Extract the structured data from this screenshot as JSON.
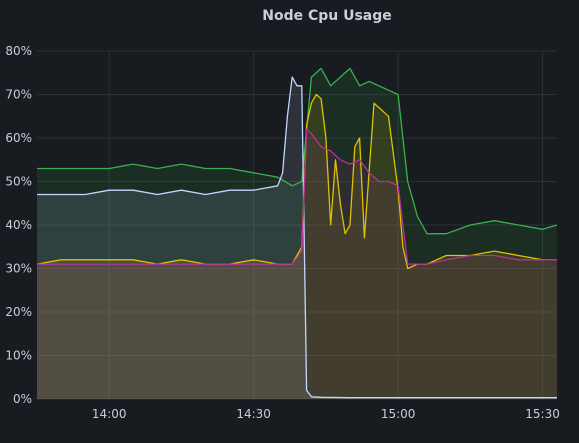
{
  "panel": {
    "title": "Node Cpu Usage"
  },
  "chart_data": {
    "type": "area",
    "title": "Node Cpu Usage",
    "xlabel": "",
    "ylabel": "",
    "x_ticks": [
      "14:00",
      "14:30",
      "15:00",
      "15:30"
    ],
    "y_ticks": [
      "0%",
      "10%",
      "20%",
      "30%",
      "40%",
      "50%",
      "60%",
      "70%",
      "80%"
    ],
    "xlim": [
      "13:45",
      "15:33"
    ],
    "ylim": [
      0,
      80
    ],
    "grid": true,
    "legend": "none",
    "colors": {
      "green": "#37b24d",
      "lightblue": "#c0d8ff",
      "yellow": "#e0c200",
      "magenta": "#b8309a",
      "background": "#181b1f",
      "grid": "#2c2f36",
      "text": "#ccccdc"
    },
    "series": [
      {
        "color": "green",
        "x": [
          "13:45",
          "13:50",
          "13:55",
          "14:00",
          "14:05",
          "14:10",
          "14:15",
          "14:20",
          "14:25",
          "14:30",
          "14:35",
          "14:38",
          "14:40",
          "14:42",
          "14:44",
          "14:46",
          "14:48",
          "14:50",
          "14:52",
          "14:54",
          "14:56",
          "14:58",
          "15:00",
          "15:02",
          "15:04",
          "15:06",
          "15:10",
          "15:15",
          "15:20",
          "15:25",
          "15:30",
          "15:33"
        ],
        "values": [
          53,
          53,
          53,
          53,
          54,
          53,
          54,
          53,
          53,
          52,
          51,
          49,
          50,
          74,
          76,
          72,
          74,
          76,
          72,
          73,
          72,
          71,
          70,
          50,
          42,
          38,
          38,
          40,
          41,
          40,
          39,
          40
        ]
      },
      {
        "color": "lightblue",
        "x": [
          "13:45",
          "13:50",
          "13:55",
          "14:00",
          "14:05",
          "14:10",
          "14:15",
          "14:20",
          "14:25",
          "14:30",
          "14:35",
          "14:36",
          "14:37",
          "14:38",
          "14:39",
          "14:40",
          "14:41",
          "14:42",
          "14:44",
          "14:50",
          "15:00",
          "15:10",
          "15:20",
          "15:30",
          "15:33"
        ],
        "values": [
          47,
          47,
          47,
          48,
          48,
          47,
          48,
          47,
          48,
          48,
          49,
          52,
          65,
          74,
          72,
          72,
          2,
          0.5,
          0.4,
          0.3,
          0.3,
          0.3,
          0.3,
          0.3,
          0.3
        ]
      },
      {
        "color": "yellow",
        "x": [
          "13:45",
          "13:50",
          "13:55",
          "14:00",
          "14:05",
          "14:10",
          "14:15",
          "14:20",
          "14:25",
          "14:30",
          "14:35",
          "14:38",
          "14:40",
          "14:41",
          "14:42",
          "14:43",
          "14:44",
          "14:45",
          "14:46",
          "14:47",
          "14:48",
          "14:49",
          "14:50",
          "14:51",
          "14:52",
          "14:53",
          "14:55",
          "14:58",
          "15:00",
          "15:01",
          "15:02",
          "15:04",
          "15:06",
          "15:10",
          "15:15",
          "15:20",
          "15:25",
          "15:30",
          "15:33"
        ],
        "values": [
          31,
          32,
          32,
          32,
          32,
          31,
          32,
          31,
          31,
          32,
          31,
          31,
          35,
          63,
          68,
          70,
          69,
          60,
          40,
          55,
          45,
          38,
          40,
          58,
          60,
          37,
          68,
          65,
          48,
          35,
          30,
          31,
          31,
          33,
          33,
          34,
          33,
          32,
          32
        ]
      },
      {
        "color": "magenta",
        "x": [
          "13:45",
          "13:50",
          "13:55",
          "14:00",
          "14:05",
          "14:10",
          "14:15",
          "14:20",
          "14:25",
          "14:30",
          "14:35",
          "14:38",
          "14:40",
          "14:41",
          "14:42",
          "14:44",
          "14:46",
          "14:48",
          "14:50",
          "14:52",
          "14:54",
          "14:56",
          "14:58",
          "15:00",
          "15:02",
          "15:04",
          "15:06",
          "15:10",
          "15:15",
          "15:20",
          "15:25",
          "15:30",
          "15:33"
        ],
        "values": [
          31,
          31,
          31,
          31,
          31,
          31,
          31,
          31,
          31,
          31,
          31,
          31,
          34,
          62,
          61,
          58,
          57,
          55,
          54,
          55,
          52,
          50,
          50,
          49,
          31,
          31,
          31,
          32,
          33,
          33,
          32,
          32,
          32
        ]
      }
    ]
  }
}
